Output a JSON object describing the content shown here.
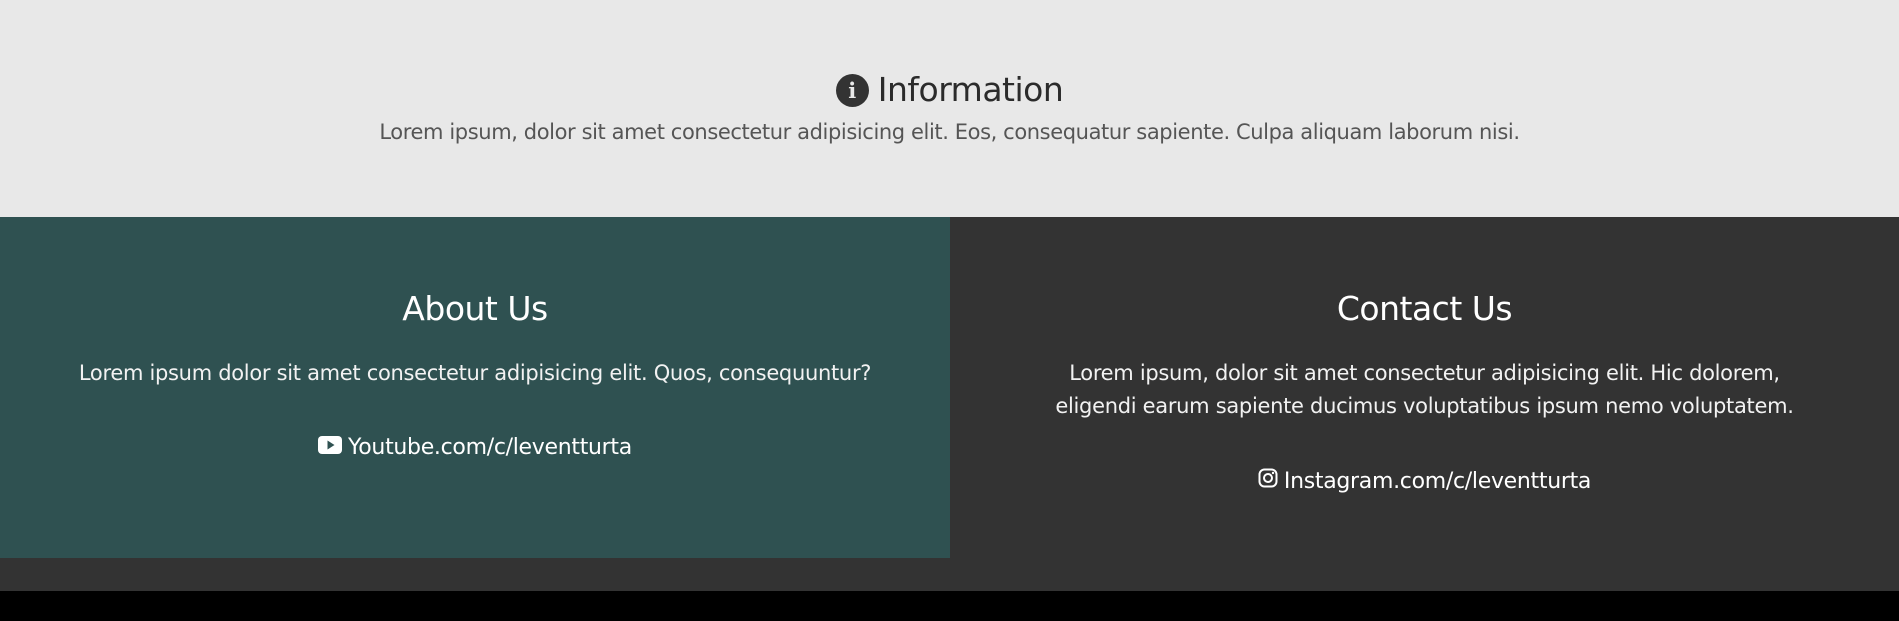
{
  "info": {
    "icon": "info-circle-icon",
    "title": "Information",
    "text": "Lorem ipsum, dolor sit amet consectetur adipisicing elit. Eos, consequatur sapiente. Culpa aliquam laborum nisi."
  },
  "about": {
    "title": "About Us",
    "text": "Lorem ipsum dolor sit amet consectetur adipisicing elit. Quos, consequuntur?",
    "link_icon": "youtube-icon",
    "link_text": "Youtube.com/c/leventturta"
  },
  "contact": {
    "title": "Contact Us",
    "text": "Lorem ipsum, dolor sit amet consectetur adipisicing elit. Hic dolorem, eligendi earum sapiente ducimus voluptatibus ipsum nemo voluptatem.",
    "link_icon": "instagram-icon",
    "link_text": "Instagram.com/c/leventturta"
  },
  "colors": {
    "info_bg": "#e8e8e8",
    "about_bg": "#2f5151",
    "contact_bg": "#333333",
    "footer_bg": "#000000"
  }
}
